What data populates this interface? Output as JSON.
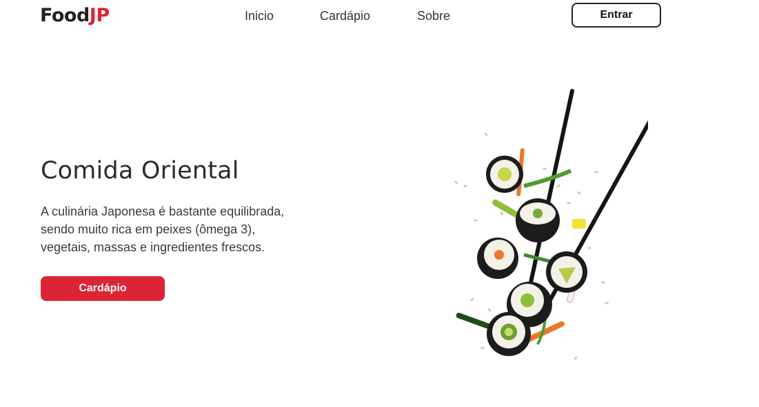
{
  "header": {
    "logo": {
      "part1": "Food",
      "part2": "JP"
    },
    "nav": [
      {
        "label": "Inicio"
      },
      {
        "label": "Cardápio"
      },
      {
        "label": "Sobre"
      }
    ],
    "login_label": "Entrar"
  },
  "hero": {
    "title": "Comida Oriental",
    "text_lines": [
      "A culinária Japonesa é bastante equilibrada,",
      "sendo muito rica em peixes (ômega 3),",
      "vegetais, massas e ingredientes frescos."
    ],
    "cta_label": "Cardápio",
    "image": "sushi-with-chopsticks"
  },
  "colors": {
    "brand_red": "#dc2435",
    "text_dark": "#2b2b2b",
    "background": "#ffffff"
  }
}
